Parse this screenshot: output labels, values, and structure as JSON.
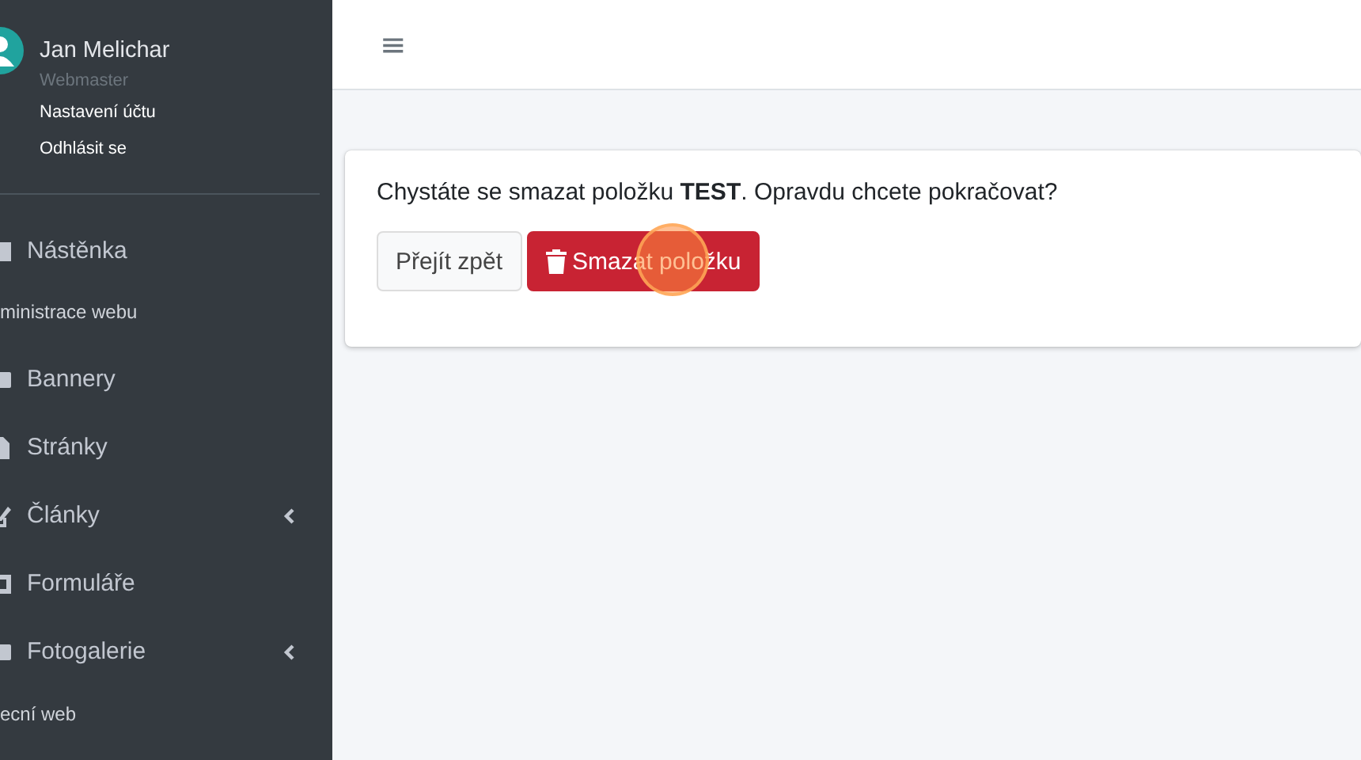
{
  "user": {
    "name": "Jan Melichar",
    "role": "Webmaster",
    "links": [
      "Nastavení účtu",
      "Odhlásit se"
    ]
  },
  "menu": [
    {
      "kind": "link",
      "label": "Nástěnka",
      "expandable": false
    },
    {
      "kind": "header",
      "label": "ministrace webu"
    },
    {
      "kind": "link",
      "label": "Bannery",
      "expandable": false
    },
    {
      "kind": "link",
      "label": "Stránky",
      "expandable": false
    },
    {
      "kind": "link",
      "label": "Články",
      "expandable": true
    },
    {
      "kind": "link",
      "label": "Formuláře",
      "expandable": false
    },
    {
      "kind": "link",
      "label": "Fotogalerie",
      "expandable": true
    },
    {
      "kind": "header",
      "label": "ecní web"
    }
  ],
  "topbar": {
    "menu_glyph": "≡"
  },
  "dialog": {
    "message": "Chystáte se smazat položku **TEST**. Opravdu chcete pokračovat?",
    "buttons": [
      {
        "kind": "secondary",
        "label": "Přejít zpět"
      },
      {
        "kind": "danger",
        "label": "Smazat položku"
      }
    ]
  }
}
